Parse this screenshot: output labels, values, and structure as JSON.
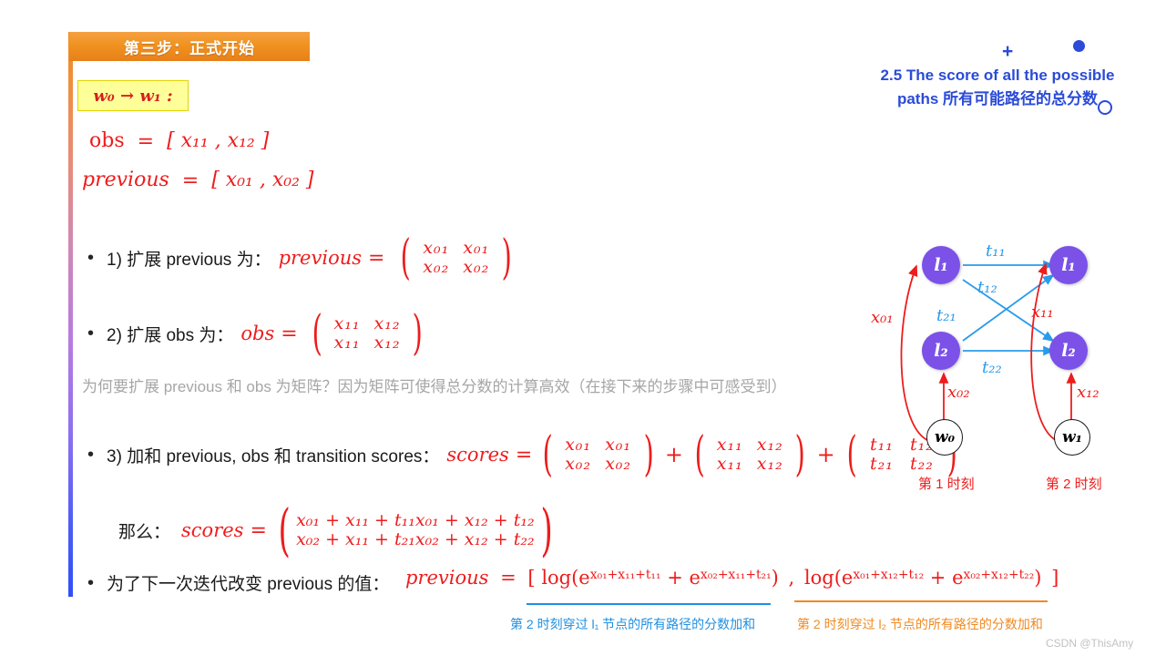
{
  "slide": {
    "banner_title": "第三步：正式开始",
    "w_box": "w₀ → w₁ :",
    "right_heading_line1": "2.5 The score of all the possible",
    "right_heading_line2": "paths 所有可能路径的总分数",
    "watermark": "CSDN @ThisAmy",
    "grey_note": "为何要扩展 previous 和 obs 为矩阵？因为矩阵可使得总分数的计算高效（在接下来的步骤中可感受到）"
  },
  "equations": {
    "obs_label": "obs",
    "obs_vector": "[ x₁₁ ,  x₁₂ ]",
    "previous_label": "previous",
    "previous_vector": "[ x₀₁ ,  x₀₂ ]"
  },
  "bullets": [
    {
      "index": "1)",
      "text_zh": "扩展 previous 为：",
      "result_label": "previous",
      "matrix": [
        [
          "x₀₁",
          "x₀₁"
        ],
        [
          "x₀₂",
          "x₀₂"
        ]
      ]
    },
    {
      "index": "2)",
      "text_zh": "扩展 obs 为：",
      "result_label": "obs",
      "matrix": [
        [
          "x₁₁",
          "x₁₂"
        ],
        [
          "x₁₁",
          "x₁₂"
        ]
      ]
    },
    {
      "index": "3)",
      "text_zh": "加和 previous, obs 和 transition scores：",
      "result_label": "scores",
      "matrices": [
        [
          [
            "x₀₁",
            "x₀₁"
          ],
          [
            "x₀₂",
            "x₀₂"
          ]
        ],
        [
          [
            "x₁₁",
            "x₁₂"
          ],
          [
            "x₁₁",
            "x₁₂"
          ]
        ],
        [
          [
            "t₁₁",
            "t₁₂"
          ],
          [
            "t₂₁",
            "t₂₂"
          ]
        ]
      ],
      "operators": [
        "+",
        "+"
      ]
    },
    {
      "index": "",
      "text_zh": "为了下一次迭代改变 previous 的值：",
      "result_label": "previous"
    }
  ],
  "result_line": {
    "prefix": "那么：",
    "label": "scores",
    "matrix": [
      [
        "x₀₁ + x₁₁ + t₁₁",
        "x₀₁ + x₁₂ + t₁₂"
      ],
      [
        "x₀₂ + x₁₁ + t₂₁",
        "x₀₂ + x₁₂ + t₂₂"
      ]
    ]
  },
  "final_formula": {
    "lhs": "previous",
    "eq": "=",
    "open": "[",
    "term1_pre": "log(e",
    "term1_sup1": "x₀₁+x₁₁+t₁₁",
    "term1_mid": " + e",
    "term1_sup2": "x₀₂+x₁₁+t₂₁",
    "term1_close": ")",
    "comma": ",",
    "term2_pre": "log(e",
    "term2_sup1": "x₀₁+x₁₂+t₁₂",
    "term2_mid": " + e",
    "term2_sup2": "x₀₂+x₁₂+t₂₂",
    "term2_close": ")",
    "close": "]"
  },
  "captions": {
    "blue": "第 2 时刻穿过 l₁ 节点的所有路径的分数加和",
    "orange": "第 2 时刻穿过 l₂ 节点的所有路径的分数加和"
  },
  "diagram": {
    "nodes": {
      "t1_l1": "l₁",
      "t1_l2": "l₂",
      "t2_l1": "l₁",
      "t2_l2": "l₂",
      "w0": "w₀",
      "w1": "w₁"
    },
    "transition_labels": [
      "t₁₁",
      "t₁₂",
      "t₂₁",
      "t₂₂"
    ],
    "emission_labels": [
      "x₀₁",
      "x₀₂",
      "x₁₁",
      "x₁₂"
    ],
    "time_labels": [
      "第 1 时刻",
      "第 2 时刻"
    ]
  },
  "colors": {
    "red": "#ee1c1c",
    "blue_arrow": "#2a9bea",
    "node_purple": "#7b51e8",
    "heading_blue": "#2b4bd8",
    "banner_orange": "#f0921f",
    "caption_orange": "#ef8a22",
    "caption_blue": "#1f8fe0",
    "grey_note": "#a6a6a6"
  }
}
